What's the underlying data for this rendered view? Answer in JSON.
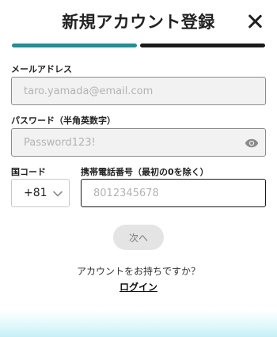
{
  "header": {
    "title": "新規アカウント登録",
    "close_icon": "close-icon"
  },
  "progress": {
    "current_step": 1,
    "total_steps": 2,
    "active_color": "#1f8f94",
    "inactive_color": "#1a1a1a"
  },
  "form": {
    "email": {
      "label": "メールアドレス",
      "placeholder": "taro.yamada@email.com",
      "value": ""
    },
    "password": {
      "label": "パスワード（半角英数字）",
      "placeholder": "Password123!",
      "value": "",
      "toggle_icon": "eye-icon"
    },
    "country": {
      "label": "国コード",
      "value": "+81",
      "icon": "chevron-down-icon"
    },
    "phone": {
      "label": "携帯電話番号（最初の0を除く）",
      "placeholder": "8012345678",
      "value": ""
    }
  },
  "actions": {
    "next_label": "次へ",
    "prompt": "アカウントをお持ちですか？",
    "login_label": "ログイン"
  },
  "colors": {
    "accent": "#1f8f94",
    "footer_tint": "#c6f0f6"
  }
}
